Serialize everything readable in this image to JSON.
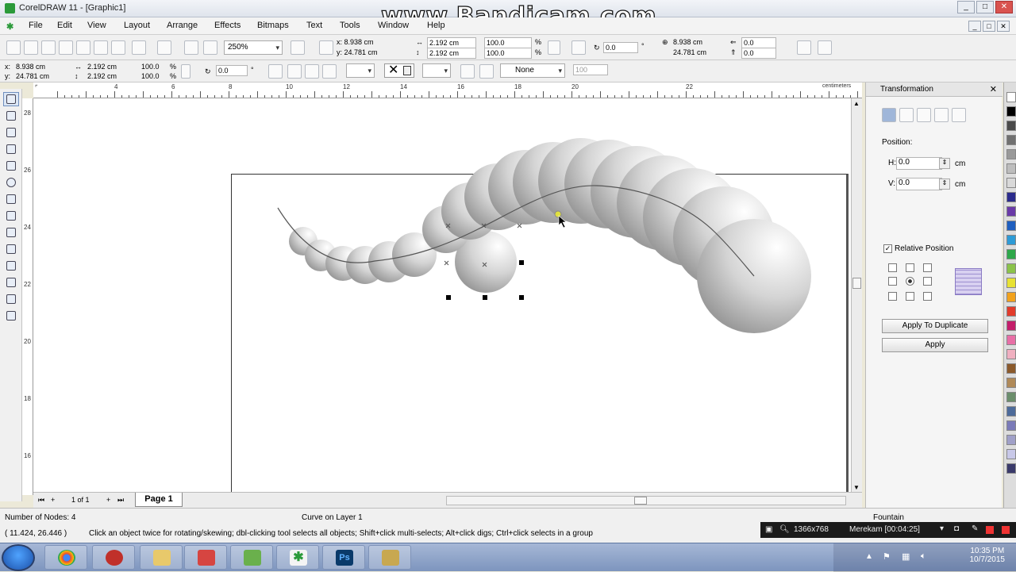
{
  "window": {
    "title": "CorelDRAW 11 - [Graphic1]",
    "watermark": "www.Bandicam.com",
    "minimize": "_",
    "maximize": "□",
    "close": "✕"
  },
  "menu": [
    "File",
    "Edit",
    "View",
    "Layout",
    "Arrange",
    "Effects",
    "Bitmaps",
    "Text",
    "Tools",
    "Window",
    "Help"
  ],
  "toolbar1": {
    "zoom": "250%",
    "x": "x: 8.938 cm",
    "y": "y: 24.781 cm",
    "w": "2.192 cm",
    "h": "2.192 cm",
    "sx": "100.0",
    "sy": "100.0",
    "pct": "%",
    "rotation": "0.0",
    "deg": "°",
    "x2": "8.938 cm",
    "y2": "24.781 cm",
    "skew1": "0.0",
    "skew2": "0.0"
  },
  "toolbar2": {
    "x": "8.938 cm",
    "y": "24.781 cm",
    "w": "2.192 cm",
    "h": "2.192 cm",
    "sx": "100.0",
    "sy": "100.0",
    "pct": "%",
    "rotation": "0.0",
    "deg": "°",
    "outline": "None",
    "opacity": "100"
  },
  "ruler": {
    "unit": "centimeters",
    "h_labels": [
      "4",
      "6",
      "8",
      "10",
      "12",
      "14",
      "16",
      "18",
      "20",
      "22"
    ],
    "v_labels": [
      "28",
      "26",
      "24",
      "22",
      "20",
      "18",
      "16"
    ]
  },
  "pages": {
    "counter": "1 of 1",
    "tab": "Page 1"
  },
  "docker": {
    "title": "Transformation",
    "position_label": "Position:",
    "h_label": "H:",
    "h_value": "0.0",
    "v_label": "V:",
    "v_value": "0.0",
    "unit": "cm",
    "relative_label": "Relative Position",
    "apply_duplicate": "Apply To Duplicate",
    "apply": "Apply"
  },
  "status": {
    "nodes": "Number of Nodes: 4",
    "object": "Curve on Layer 1",
    "coords": "( 11.424, 26.446 )",
    "hint": "Click an object twice for rotating/skewing; dbl-clicking tool selects all objects; Shift+click multi-selects; Alt+click digs; Ctrl+click selects in a group",
    "fill": "Fountain"
  },
  "recorder": {
    "resolution": "1366x768",
    "label": "Merekam [00:04:25]"
  },
  "clock": {
    "time": "10:35 PM",
    "date": "10/7/2015"
  },
  "palette": [
    "#ffffff",
    "#000000",
    "#4a4a4a",
    "#707070",
    "#999999",
    "#bdbdbd",
    "#d9d9d9",
    "#2b2b8c",
    "#6a3aa8",
    "#1f5fbf",
    "#2e9bd6",
    "#2ea84a",
    "#8bc34a",
    "#e8e233",
    "#f2a21c",
    "#e23b2a",
    "#c41e6a",
    "#e86fa6",
    "#f0b0c0",
    "#8b5a2b",
    "#b08a58",
    "#6b8e6b",
    "#4d6b9a",
    "#7a7ab8",
    "#a0a0c8",
    "#c8c8e8",
    "#3a3a6a"
  ]
}
